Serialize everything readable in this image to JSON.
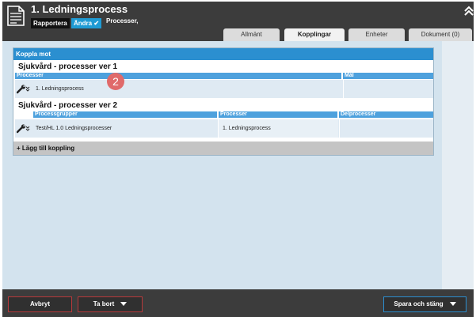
{
  "header": {
    "title": "1. Ledningsprocess",
    "rapportera_label": "Rapportera",
    "andra_label": "Ändra",
    "subtitle": "Processer,"
  },
  "tabs": [
    {
      "label": "Allmänt"
    },
    {
      "label": "Kopplingar"
    },
    {
      "label": "Enheter"
    },
    {
      "label": "Dokument (0)"
    }
  ],
  "panel": {
    "title": "Koppla mot",
    "groups": [
      {
        "title": "Sjukvård - processer ver 1",
        "columns": [
          "Processer",
          "Mål"
        ],
        "rows": [
          [
            "1. Ledningsprocess",
            ""
          ]
        ]
      },
      {
        "title": "Sjukvård - processer ver 2",
        "columns": [
          "Processgrupper",
          "Processer",
          "Delprocesser"
        ],
        "rows": [
          [
            "Test/HL 1.0 Ledningsprocesser",
            "1. Ledningsprocess",
            ""
          ]
        ]
      }
    ],
    "add_label": "+ Lägg till koppling"
  },
  "step_badge": "2",
  "footer": {
    "cancel_label": "Avbryt",
    "delete_label": "Ta bort",
    "save_label": "Spara och stäng"
  },
  "colors": {
    "header_bg": "#3c3c3c",
    "accent_blue": "#2b8fd0",
    "danger_red": "#b8393b",
    "content_bg": "#d3e3ee",
    "badge": "#e06a6a"
  }
}
